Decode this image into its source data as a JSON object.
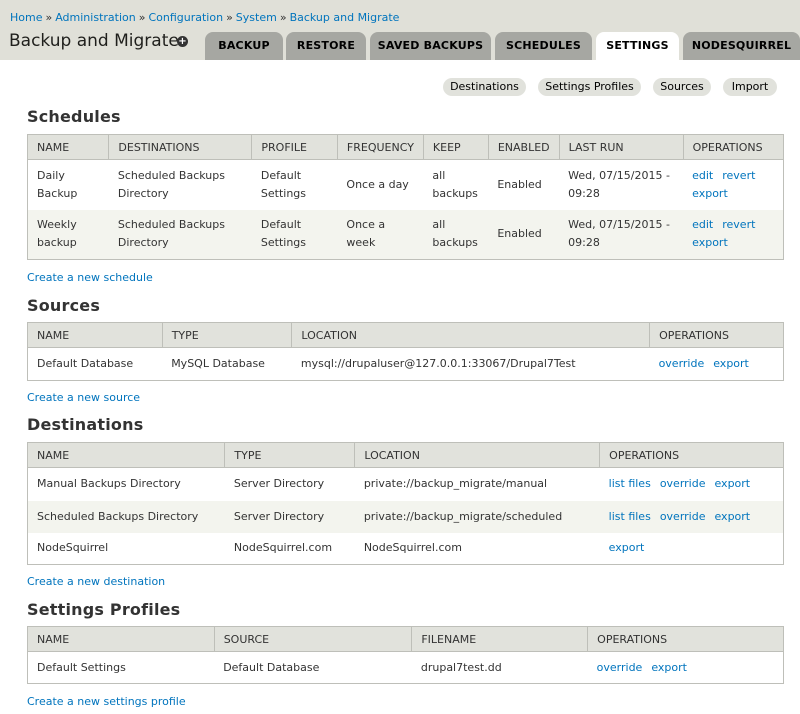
{
  "breadcrumb": [
    "Home",
    "Administration",
    "Configuration",
    "System",
    "Backup and Migrate"
  ],
  "breadcrumb_separator": "»",
  "page_title": "Backup and Migrate",
  "tabs": [
    "BACKUP",
    "RESTORE",
    "SAVED BACKUPS",
    "SCHEDULES",
    "SETTINGS",
    "NODESQUIRREL"
  ],
  "active_tab": "SETTINGS",
  "subtabs": [
    "Destinations",
    "Settings Profiles",
    "Sources",
    "Import"
  ],
  "schedules": {
    "title": "Schedules",
    "headers": [
      "NAME",
      "DESTINATIONS",
      "PROFILE",
      "FREQUENCY",
      "KEEP",
      "ENABLED",
      "LAST RUN",
      "OPERATIONS"
    ],
    "rows": [
      {
        "name": [
          "Daily",
          "Backup"
        ],
        "destinations": [
          "Scheduled Backups",
          "Directory"
        ],
        "profile": [
          "Default",
          "Settings"
        ],
        "frequency": [
          "Once a day"
        ],
        "keep": [
          "all",
          "backups"
        ],
        "enabled": "Enabled",
        "last_run": [
          "Wed, 07/15/2015 -",
          "09:28"
        ],
        "operations": [
          [
            "edit",
            "revert"
          ],
          [
            "export"
          ]
        ]
      },
      {
        "name": [
          "Weekly",
          "backup"
        ],
        "destinations": [
          "Scheduled Backups",
          "Directory"
        ],
        "profile": [
          "Default",
          "Settings"
        ],
        "frequency": [
          "Once a",
          "week"
        ],
        "keep": [
          "all",
          "backups"
        ],
        "enabled": "Enabled",
        "last_run": [
          "Wed, 07/15/2015 -",
          "09:28"
        ],
        "operations": [
          [
            "edit",
            "revert"
          ],
          [
            "export"
          ]
        ]
      }
    ],
    "create_link": "Create a new schedule"
  },
  "sources": {
    "title": "Sources",
    "headers": [
      "NAME",
      "TYPE",
      "LOCATION",
      "OPERATIONS"
    ],
    "rows": [
      {
        "name": "Default Database",
        "type": "MySQL Database",
        "location": "mysql://drupaluser@127.0.0.1:33067/Drupal7Test",
        "operations": [
          "override",
          "export"
        ]
      }
    ],
    "create_link": "Create a new source"
  },
  "destinations": {
    "title": "Destinations",
    "headers": [
      "NAME",
      "TYPE",
      "LOCATION",
      "OPERATIONS"
    ],
    "rows": [
      {
        "name": "Manual Backups Directory",
        "type": "Server Directory",
        "location": "private://backup_migrate/manual",
        "operations": [
          "list files",
          "override",
          "export"
        ]
      },
      {
        "name": "Scheduled Backups Directory",
        "type": "Server Directory",
        "location": "private://backup_migrate/scheduled",
        "operations": [
          "list files",
          "override",
          "export"
        ]
      },
      {
        "name": "NodeSquirrel",
        "type": "NodeSquirrel.com",
        "location": "NodeSquirrel.com",
        "operations": [
          "export"
        ]
      }
    ],
    "create_link": "Create a new destination"
  },
  "profiles": {
    "title": "Settings Profiles",
    "headers": [
      "NAME",
      "SOURCE",
      "FILENAME",
      "OPERATIONS"
    ],
    "rows": [
      {
        "name": "Default Settings",
        "source": "Default Database",
        "filename": "drupal7test.dd",
        "operations": [
          "override",
          "export"
        ]
      }
    ],
    "create_link": "Create a new settings profile"
  }
}
